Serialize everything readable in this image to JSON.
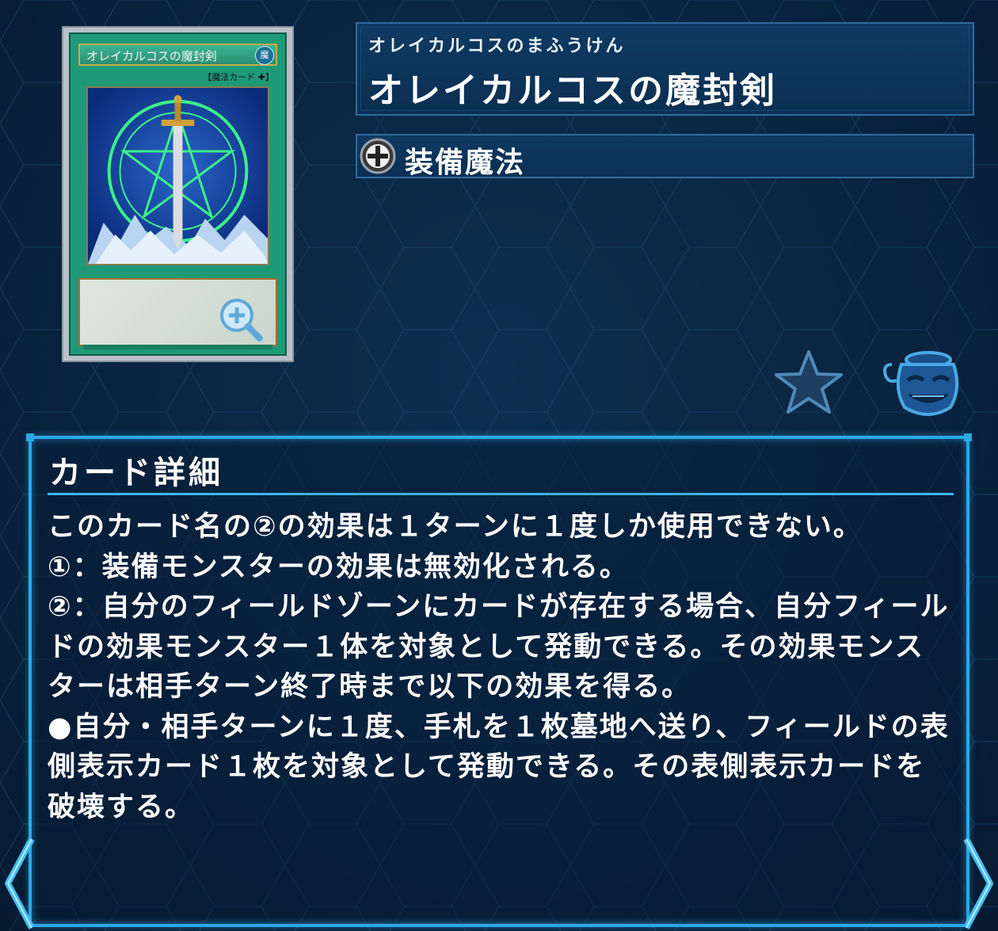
{
  "card": {
    "furigana": "オレイカルコスのまふうけん",
    "name": "オレイカルコスの魔封剣",
    "card_face_name": "オレイカルコスの魔封剣",
    "card_face_attribute": "魔",
    "card_face_type_line": "【魔法カード ✚】",
    "spell_type": "装備魔法"
  },
  "detail": {
    "heading": "カード詳細",
    "text": "このカード名の②の効果は１ターンに１度しか使用できない。\n①：装備モンスターの効果は無効化される。\n②：自分のフィールドゾーンにカードが存在する場合、自分フィールドの効果モンスター１体を対象として発動できる。その効果モンスターは相手ターン終了時まで以下の効果を得る。\n●自分・相手ターンに１度、手札を１枚墓地へ送り、フィールドの表側表示カード１枚を対象として発動できる。その表側表示カードを破壊する。"
  },
  "icons": {
    "zoom": "zoom-in-icon",
    "equip": "equip-spell-icon",
    "favorite": "star-icon",
    "pot": "pot-of-greed-icon",
    "prev": "chevron-left-icon",
    "next": "chevron-right-icon"
  },
  "colors": {
    "accent": "#2aa9e6",
    "background": "#0a2440",
    "spell_card": "#1f9a78"
  }
}
